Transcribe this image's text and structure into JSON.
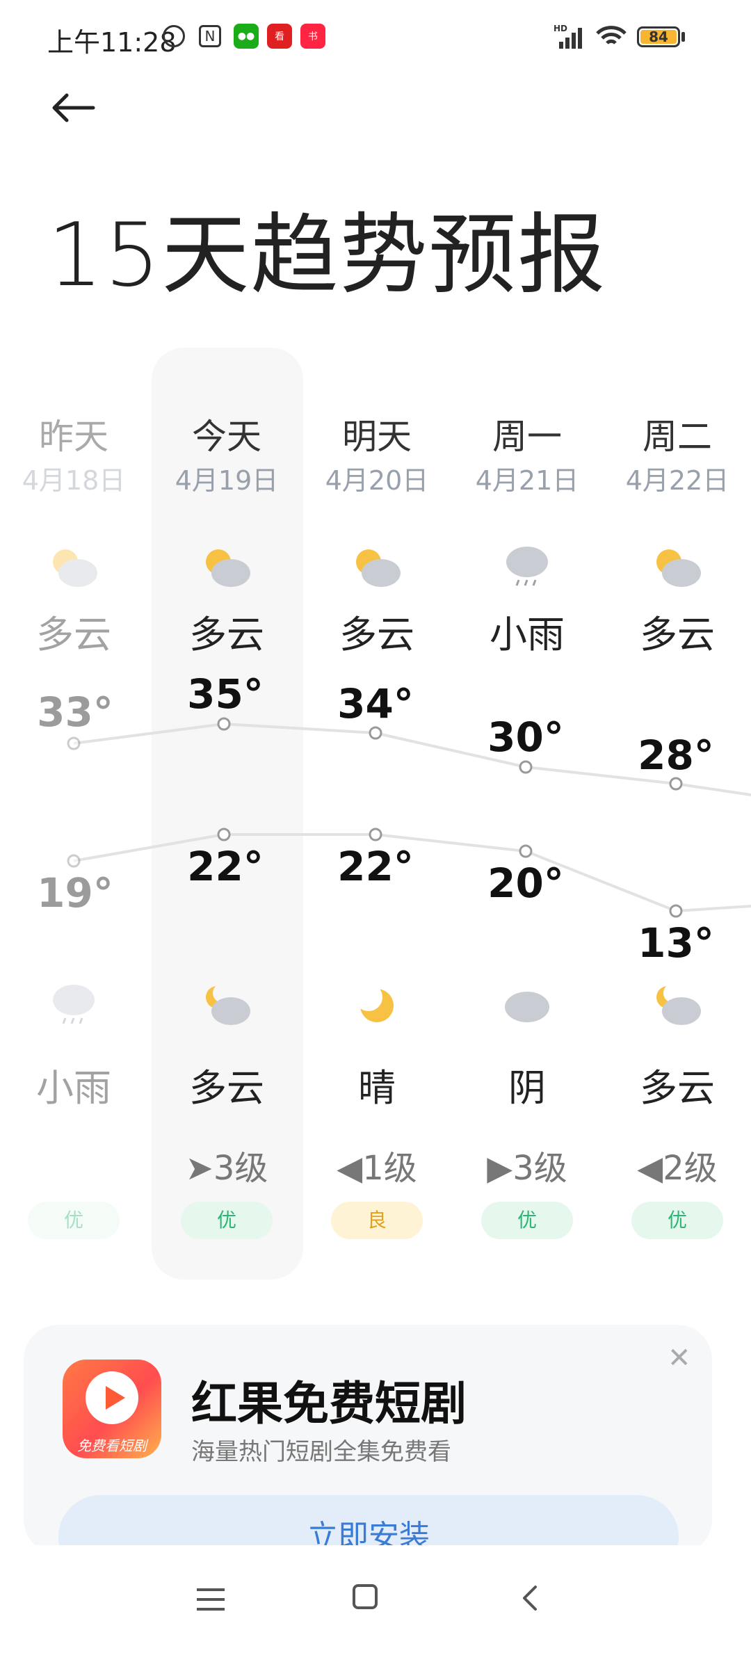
{
  "status": {
    "time": "上午11:28",
    "battery": "84",
    "network": "HD"
  },
  "title": "15天趋势预报",
  "days": [
    {
      "name": "昨天",
      "date": "4月18日",
      "day_weather": "多云",
      "high": "33°",
      "low": "19°",
      "night_weather": "小雨",
      "wind": "",
      "aqi": "优",
      "aqi_level": "good"
    },
    {
      "name": "今天",
      "date": "4月19日",
      "day_weather": "多云",
      "high": "35°",
      "low": "22°",
      "night_weather": "多云",
      "wind": "3级",
      "aqi": "优",
      "aqi_level": "good"
    },
    {
      "name": "明天",
      "date": "4月20日",
      "day_weather": "多云",
      "high": "34°",
      "low": "22°",
      "night_weather": "晴",
      "wind": "1级",
      "aqi": "良",
      "aqi_level": "moderate"
    },
    {
      "name": "周一",
      "date": "4月21日",
      "day_weather": "小雨",
      "high": "30°",
      "low": "20°",
      "night_weather": "阴",
      "wind": "3级",
      "aqi": "优",
      "aqi_level": "good"
    },
    {
      "name": "周二",
      "date": "4月22日",
      "day_weather": "多云",
      "high": "28°",
      "low": "13°",
      "night_weather": "多云",
      "wind": "2级",
      "aqi": "优",
      "aqi_level": "good"
    }
  ],
  "ad": {
    "title": "红果免费短剧",
    "subtitle": "海量热门短剧全集免费看",
    "button": "立即安装",
    "icon_text": "免费看短剧"
  },
  "colors": {
    "good_bg": "#e6f8ee",
    "good_fg": "#2bb673",
    "moderate_bg": "#fff3d6",
    "moderate_fg": "#e0a21a"
  }
}
